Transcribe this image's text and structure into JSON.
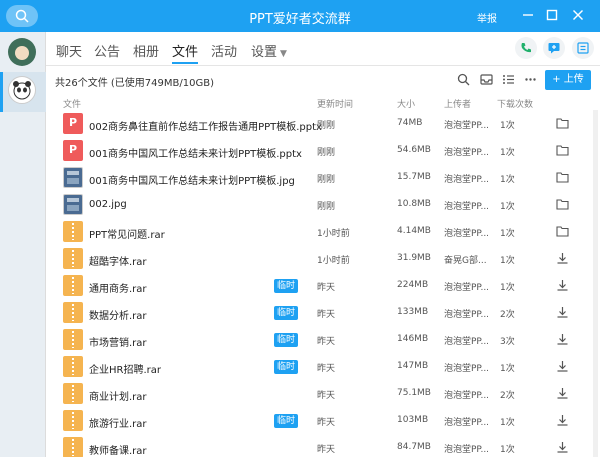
{
  "window": {
    "title": "PPT爱好者交流群",
    "report_label": "举报"
  },
  "tabs": [
    {
      "label": "聊天"
    },
    {
      "label": "公告"
    },
    {
      "label": "相册"
    },
    {
      "label": "文件"
    },
    {
      "label": "活动"
    },
    {
      "label": "设置"
    }
  ],
  "toolbar": {
    "summary": "共26个文件 (已使用749MB/10GB)",
    "upload_label": "+ 上传"
  },
  "columns": {
    "file": "文件",
    "time": "更新时间",
    "size": "大小",
    "uploader": "上传者",
    "downloads": "下载次数"
  },
  "files": [
    {
      "name": "002商务鼻往直前作总结工作报告通用PPT模板.pptx",
      "type": "ppt",
      "tag": "",
      "time": "刚刚",
      "size": "74MB",
      "uploader": "泡泡堂PP...",
      "downloads": "1次",
      "action": "folder"
    },
    {
      "name": "001商务中国风工作总结未来计划PPT模板.pptx",
      "type": "ppt",
      "tag": "",
      "time": "刚刚",
      "size": "54.6MB",
      "uploader": "泡泡堂PP...",
      "downloads": "1次",
      "action": "folder"
    },
    {
      "name": "001商务中国风工作总结未来计划PPT模板.jpg",
      "type": "img",
      "tag": "",
      "time": "刚刚",
      "size": "15.7MB",
      "uploader": "泡泡堂PP...",
      "downloads": "1次",
      "action": "folder"
    },
    {
      "name": "002.jpg",
      "type": "img",
      "tag": "",
      "time": "刚刚",
      "size": "10.8MB",
      "uploader": "泡泡堂PP...",
      "downloads": "1次",
      "action": "folder"
    },
    {
      "name": "PPT常见问题.rar",
      "type": "rar",
      "tag": "",
      "time": "1小时前",
      "size": "4.14MB",
      "uploader": "泡泡堂PP...",
      "downloads": "1次",
      "action": "folder"
    },
    {
      "name": "超酷字体.rar",
      "type": "rar",
      "tag": "",
      "time": "1小时前",
      "size": "31.9MB",
      "uploader": "奋晃G部...",
      "downloads": "1次",
      "action": "download"
    },
    {
      "name": "通用商务.rar",
      "type": "rar",
      "tag": "临时",
      "time": "昨天",
      "size": "224MB",
      "uploader": "泡泡堂PP...",
      "downloads": "1次",
      "action": "download"
    },
    {
      "name": "数据分析.rar",
      "type": "rar",
      "tag": "临时",
      "time": "昨天",
      "size": "133MB",
      "uploader": "泡泡堂PP...",
      "downloads": "2次",
      "action": "download"
    },
    {
      "name": "市场营销.rar",
      "type": "rar",
      "tag": "临时",
      "time": "昨天",
      "size": "146MB",
      "uploader": "泡泡堂PP...",
      "downloads": "3次",
      "action": "download"
    },
    {
      "name": "企业HR招聘.rar",
      "type": "rar",
      "tag": "临时",
      "time": "昨天",
      "size": "147MB",
      "uploader": "泡泡堂PP...",
      "downloads": "1次",
      "action": "download"
    },
    {
      "name": "商业计划.rar",
      "type": "rar",
      "tag": "",
      "time": "昨天",
      "size": "75.1MB",
      "uploader": "泡泡堂PP...",
      "downloads": "2次",
      "action": "download"
    },
    {
      "name": "旅游行业.rar",
      "type": "rar",
      "tag": "临时",
      "time": "昨天",
      "size": "103MB",
      "uploader": "泡泡堂PP...",
      "downloads": "1次",
      "action": "download"
    },
    {
      "name": "教师备课.rar",
      "type": "rar",
      "tag": "",
      "time": "昨天",
      "size": "84.7MB",
      "uploader": "泡泡堂PP...",
      "downloads": "1次",
      "action": "download"
    }
  ]
}
